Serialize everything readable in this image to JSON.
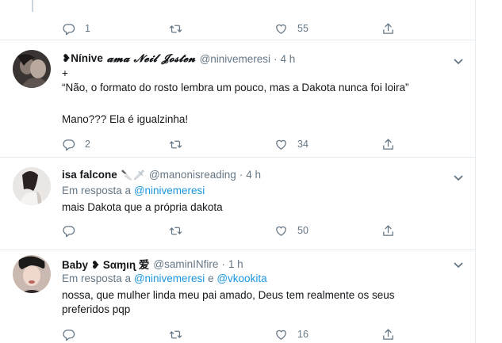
{
  "tweets": [
    {
      "counts": {
        "reply": "1",
        "retweet": "",
        "like": "55"
      }
    },
    {
      "name_part1": "❥Nínive",
      "name_part2": "𝓪𝓶𝓪 𝓝𝓮𝓲𝓵 𝓙𝓸𝓼𝓽𝓮𝓷",
      "handle": "@ninivemeresi",
      "dot": "·",
      "time": "4 h",
      "lines": [
        "+",
        "“Não, o formato do rosto lembra um pouco, mas a Dakota nunca foi loira”",
        "Mano??? Ela é igualzinha!"
      ],
      "counts": {
        "reply": "2",
        "retweet": "",
        "like": "34"
      }
    },
    {
      "name": "isa falcone",
      "name_emoji": "🔪🗡",
      "handle": "@manonisreading",
      "dot": "·",
      "time": "4 h",
      "reply_prefix": "Em resposta a",
      "reply_handle": "@ninivemeresi",
      "text": "mais Dakota que a própria dakota",
      "counts": {
        "reply": "",
        "retweet": "",
        "like": "50"
      }
    },
    {
      "name": "Baby ❥ Sαɱιɳ 爱",
      "handle": "@saminINfire",
      "dot": "·",
      "time": "1 h",
      "reply_prefix": "Em resposta a",
      "reply_handle_1": "@ninivemeresi",
      "reply_conj": "e",
      "reply_handle_2": "@vkookita",
      "lines": [
        "nossa, que mulher linda meu pai amado, Deus tem realmente os seus",
        "preferidos pqp"
      ],
      "counts": {
        "reply": "",
        "retweet": "",
        "like": "16"
      }
    }
  ],
  "icons": {
    "reply": "reply-icon",
    "retweet": "retweet-icon",
    "like": "heart-icon",
    "share": "share-icon",
    "caret": "chevron-down-icon"
  },
  "colors": {
    "text": "#14171a",
    "muted": "#657786",
    "link": "#1b95e0",
    "divider": "#e6ecf0"
  }
}
